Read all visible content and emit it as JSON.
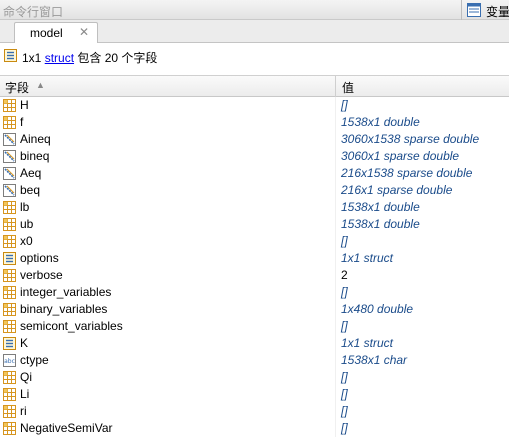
{
  "window": {
    "title": "命令行窗口",
    "workspace_label": "变量"
  },
  "tabs": [
    {
      "label": "model",
      "close": "✕"
    }
  ],
  "summary": {
    "size": "1x1",
    "class_link": "struct",
    "rest": "包含 20 个字段"
  },
  "table": {
    "col_field": "字段",
    "sort_arrow": "▲",
    "col_value": "值"
  },
  "rows": [
    {
      "name": "H",
      "value": "[]",
      "icon": "matrix-icon",
      "style": "italic"
    },
    {
      "name": "f",
      "value": "1538x1 double",
      "icon": "matrix-icon",
      "style": "italic"
    },
    {
      "name": "Aineq",
      "value": "3060x1538 sparse double",
      "icon": "sparse-icon",
      "style": "italic"
    },
    {
      "name": "bineq",
      "value": "3060x1 sparse double",
      "icon": "sparse-icon",
      "style": "italic"
    },
    {
      "name": "Aeq",
      "value": "216x1538 sparse double",
      "icon": "sparse-icon",
      "style": "italic"
    },
    {
      "name": "beq",
      "value": "216x1 sparse double",
      "icon": "sparse-icon",
      "style": "italic"
    },
    {
      "name": "lb",
      "value": "1538x1 double",
      "icon": "matrix-icon",
      "style": "italic"
    },
    {
      "name": "ub",
      "value": "1538x1 double",
      "icon": "matrix-icon",
      "style": "italic"
    },
    {
      "name": "x0",
      "value": "[]",
      "icon": "matrix-icon",
      "style": "italic"
    },
    {
      "name": "options",
      "value": "1x1 struct",
      "icon": "struct-icon",
      "style": "italic"
    },
    {
      "name": "verbose",
      "value": "2",
      "icon": "matrix-icon",
      "style": "plain"
    },
    {
      "name": "integer_variables",
      "value": "[]",
      "icon": "matrix-icon",
      "style": "italic"
    },
    {
      "name": "binary_variables",
      "value": "1x480 double",
      "icon": "matrix-icon",
      "style": "italic"
    },
    {
      "name": "semicont_variables",
      "value": "[]",
      "icon": "matrix-icon",
      "style": "italic"
    },
    {
      "name": "K",
      "value": "1x1 struct",
      "icon": "struct-icon",
      "style": "italic"
    },
    {
      "name": "ctype",
      "value": "1538x1 char",
      "icon": "char-icon",
      "style": "italic"
    },
    {
      "name": "Qi",
      "value": "[]",
      "icon": "matrix-icon",
      "style": "italic"
    },
    {
      "name": "Li",
      "value": "[]",
      "icon": "matrix-icon",
      "style": "italic"
    },
    {
      "name": "ri",
      "value": "[]",
      "icon": "matrix-icon",
      "style": "italic"
    },
    {
      "name": "NegativeSemiVar",
      "value": "[]",
      "icon": "matrix-icon",
      "style": "italic"
    }
  ],
  "colors": {
    "value_text": "#1a4b8a",
    "icon_orange": "#e8a01c",
    "icon_blue": "#3a6fb0"
  }
}
